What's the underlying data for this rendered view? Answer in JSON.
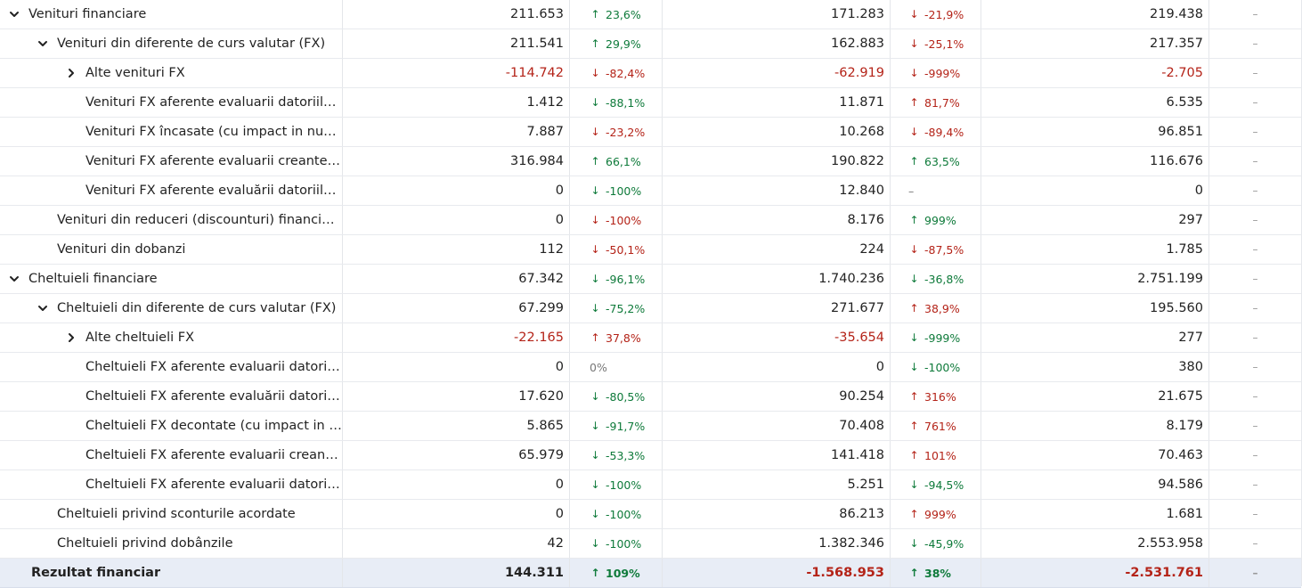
{
  "rows": [
    {
      "level": 0,
      "expander": "down",
      "label": "Venituri financiare",
      "v1": "211.653",
      "p1": {
        "dir": "up",
        "text": "23,6%",
        "tone": "green"
      },
      "v2": "171.283",
      "p2": {
        "dir": "down",
        "text": "-21,9%",
        "tone": "red"
      },
      "v3": "219.438",
      "d": "–"
    },
    {
      "level": 1,
      "expander": "down",
      "label": "Venituri din diferente de curs valutar (FX)",
      "v1": "211.541",
      "p1": {
        "dir": "up",
        "text": "29,9%",
        "tone": "green"
      },
      "v2": "162.883",
      "p2": {
        "dir": "down",
        "text": "-25,1%",
        "tone": "red"
      },
      "v3": "217.357",
      "d": "–"
    },
    {
      "level": 2,
      "expander": "right",
      "label": "Alte venituri FX",
      "v1": "-114.742",
      "v1neg": true,
      "p1": {
        "dir": "down",
        "text": "-82,4%",
        "tone": "red"
      },
      "v2": "-62.919",
      "v2neg": true,
      "p2": {
        "dir": "down",
        "text": "-999%",
        "tone": "red"
      },
      "v3": "-2.705",
      "v3neg": true,
      "d": "–"
    },
    {
      "level": 2,
      "expander": "none",
      "label": "Venituri FX aferente evaluarii datoriilor ...",
      "v1": "1.412",
      "p1": {
        "dir": "down",
        "text": "-88,1%",
        "tone": "green"
      },
      "v2": "11.871",
      "p2": {
        "dir": "up",
        "text": "81,7%",
        "tone": "red"
      },
      "v3": "6.535",
      "d": "–"
    },
    {
      "level": 2,
      "expander": "none",
      "label": "Venituri FX încasate (cu impact in num...",
      "v1": "7.887",
      "p1": {
        "dir": "down",
        "text": "-23,2%",
        "tone": "red"
      },
      "v2": "10.268",
      "p2": {
        "dir": "down",
        "text": "-89,4%",
        "tone": "red"
      },
      "v3": "96.851",
      "d": "–"
    },
    {
      "level": 2,
      "expander": "none",
      "label": "Venituri FX aferente evaluarii creantelor",
      "v1": "316.984",
      "p1": {
        "dir": "up",
        "text": "66,1%",
        "tone": "green"
      },
      "v2": "190.822",
      "p2": {
        "dir": "up",
        "text": "63,5%",
        "tone": "green"
      },
      "v3": "116.676",
      "d": "–"
    },
    {
      "level": 2,
      "expander": "none",
      "label": "Venituri FX aferente evaluării datoriilor ...",
      "v1": "0",
      "p1": {
        "dir": "down",
        "text": "-100%",
        "tone": "green"
      },
      "v2": "12.840",
      "p2": {
        "dir": "none",
        "text": "–",
        "tone": "neutral"
      },
      "v3": "0",
      "d": "–"
    },
    {
      "level": 1,
      "expander": "none",
      "label": "Venituri din reduceri (discounturi) financiar...",
      "v1": "0",
      "p1": {
        "dir": "down",
        "text": "-100%",
        "tone": "red"
      },
      "v2": "8.176",
      "p2": {
        "dir": "up",
        "text": "999%",
        "tone": "green"
      },
      "v3": "297",
      "d": "–"
    },
    {
      "level": 1,
      "expander": "none",
      "label": "Venituri din dobanzi",
      "v1": "112",
      "p1": {
        "dir": "down",
        "text": "-50,1%",
        "tone": "red"
      },
      "v2": "224",
      "p2": {
        "dir": "down",
        "text": "-87,5%",
        "tone": "red"
      },
      "v3": "1.785",
      "d": "–"
    },
    {
      "level": 0,
      "expander": "down",
      "label": "Cheltuieli financiare",
      "v1": "67.342",
      "p1": {
        "dir": "down",
        "text": "-96,1%",
        "tone": "green"
      },
      "v2": "1.740.236",
      "p2": {
        "dir": "down",
        "text": "-36,8%",
        "tone": "green"
      },
      "v3": "2.751.199",
      "d": "–"
    },
    {
      "level": 1,
      "expander": "down",
      "label": "Cheltuieli din diferente de curs valutar (FX)",
      "v1": "67.299",
      "p1": {
        "dir": "down",
        "text": "-75,2%",
        "tone": "green"
      },
      "v2": "271.677",
      "p2": {
        "dir": "up",
        "text": "38,9%",
        "tone": "red"
      },
      "v3": "195.560",
      "d": "–"
    },
    {
      "level": 2,
      "expander": "right",
      "label": "Alte cheltuieli FX",
      "v1": "-22.165",
      "v1neg": true,
      "p1": {
        "dir": "up",
        "text": "37,8%",
        "tone": "red"
      },
      "v2": "-35.654",
      "v2neg": true,
      "p2": {
        "dir": "down",
        "text": "-999%",
        "tone": "green"
      },
      "v3": "277",
      "d": "–"
    },
    {
      "level": 2,
      "expander": "none",
      "label": "Cheltuieli FX aferente evaluarii datoriil...",
      "v1": "0",
      "p1": {
        "dir": "none",
        "text": "0%",
        "tone": "neutral"
      },
      "v2": "0",
      "p2": {
        "dir": "down",
        "text": "-100%",
        "tone": "green"
      },
      "v3": "380",
      "d": "–"
    },
    {
      "level": 2,
      "expander": "none",
      "label": "Cheltuieli FX aferente evaluării datoriil...",
      "v1": "17.620",
      "p1": {
        "dir": "down",
        "text": "-80,5%",
        "tone": "green"
      },
      "v2": "90.254",
      "p2": {
        "dir": "up",
        "text": "316%",
        "tone": "red"
      },
      "v3": "21.675",
      "d": "–"
    },
    {
      "level": 2,
      "expander": "none",
      "label": "Cheltuieli FX decontate (cu impact in n...",
      "v1": "5.865",
      "p1": {
        "dir": "down",
        "text": "-91,7%",
        "tone": "green"
      },
      "v2": "70.408",
      "p2": {
        "dir": "up",
        "text": "761%",
        "tone": "red"
      },
      "v3": "8.179",
      "d": "–"
    },
    {
      "level": 2,
      "expander": "none",
      "label": "Cheltuieli FX aferente evaluarii creante...",
      "v1": "65.979",
      "p1": {
        "dir": "down",
        "text": "-53,3%",
        "tone": "green"
      },
      "v2": "141.418",
      "p2": {
        "dir": "up",
        "text": "101%",
        "tone": "red"
      },
      "v3": "70.463",
      "d": "–"
    },
    {
      "level": 2,
      "expander": "none",
      "label": "Cheltuieli FX aferente evaluarii datoriil...",
      "v1": "0",
      "p1": {
        "dir": "down",
        "text": "-100%",
        "tone": "green"
      },
      "v2": "5.251",
      "p2": {
        "dir": "down",
        "text": "-94,5%",
        "tone": "green"
      },
      "v3": "94.586",
      "d": "–"
    },
    {
      "level": 1,
      "expander": "none",
      "label": "Cheltuieli privind sconturile acordate",
      "v1": "0",
      "p1": {
        "dir": "down",
        "text": "-100%",
        "tone": "green"
      },
      "v2": "86.213",
      "p2": {
        "dir": "up",
        "text": "999%",
        "tone": "red"
      },
      "v3": "1.681",
      "d": "–"
    },
    {
      "level": 1,
      "expander": "none",
      "label": "Cheltuieli privind dobânzile",
      "v1": "42",
      "p1": {
        "dir": "down",
        "text": "-100%",
        "tone": "green"
      },
      "v2": "1.382.346",
      "p2": {
        "dir": "down",
        "text": "-45,9%",
        "tone": "green"
      },
      "v3": "2.553.958",
      "d": "–"
    }
  ],
  "total": {
    "label": "Rezultat financiar",
    "v1": "144.311",
    "p1": {
      "dir": "up",
      "text": "109%",
      "tone": "green"
    },
    "v2": "-1.568.953",
    "v2neg": true,
    "p2": {
      "dir": "up",
      "text": "38%",
      "tone": "green"
    },
    "v3": "-2.531.761",
    "v3neg": true,
    "d": "–"
  },
  "colors": {
    "green": "#0e7a3a",
    "red": "#b42318",
    "total_bg": "#e8edf6"
  },
  "icons": {
    "expanded": "chevron-down-icon",
    "collapsed": "chevron-right-icon",
    "up": "arrow-up-icon",
    "down": "arrow-down-icon"
  }
}
